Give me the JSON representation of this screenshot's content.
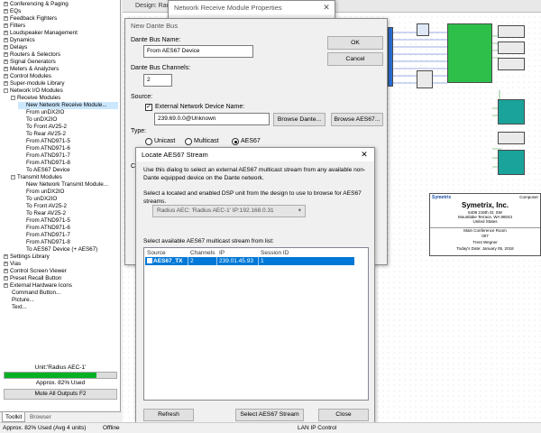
{
  "tree": {
    "items": [
      {
        "label": "Conferencing & Paging",
        "expand": "+",
        "selected": false
      },
      {
        "label": "EQs",
        "expand": "+",
        "selected": false
      },
      {
        "label": "Feedback Fighters",
        "expand": "+",
        "selected": false
      },
      {
        "label": "Filters",
        "expand": "+",
        "selected": false
      },
      {
        "label": "Loudspeaker Management",
        "expand": "+",
        "selected": false
      },
      {
        "label": "Dynamics",
        "expand": "+",
        "selected": false
      },
      {
        "label": "Delays",
        "expand": "+",
        "selected": false
      },
      {
        "label": "Routers & Selectors",
        "expand": "+",
        "selected": false
      },
      {
        "label": "Signal Generators",
        "expand": "+",
        "selected": false
      },
      {
        "label": "Meters & Analyzers",
        "expand": "+",
        "selected": false
      },
      {
        "label": "Control Modules",
        "expand": "+",
        "selected": false
      },
      {
        "label": "Super-module Library",
        "expand": "+",
        "selected": false
      },
      {
        "label": "Network I/O Modules",
        "expand": "-",
        "selected": false
      },
      {
        "label": "Receive Modules",
        "expand": "-",
        "selected": false
      },
      {
        "label": "New Network Receive Module...",
        "expand": "",
        "selected": true
      },
      {
        "label": "From unDX2IO",
        "expand": "",
        "selected": false
      },
      {
        "label": "To unDX2IO",
        "expand": "",
        "selected": false
      },
      {
        "label": "To Front AV25-2",
        "expand": "",
        "selected": false
      },
      {
        "label": "To Rear AV25-2",
        "expand": "",
        "selected": false
      },
      {
        "label": "From ATND971-5",
        "expand": "",
        "selected": false
      },
      {
        "label": "From ATND971-6",
        "expand": "",
        "selected": false
      },
      {
        "label": "From ATND971-7",
        "expand": "",
        "selected": false
      },
      {
        "label": "From ATND971-8",
        "expand": "",
        "selected": false
      },
      {
        "label": "To AES67 Device",
        "expand": "",
        "selected": false
      },
      {
        "label": "Transmit Modules",
        "expand": "-",
        "selected": false
      },
      {
        "label": "New Network Transmit Module...",
        "expand": "",
        "selected": false
      },
      {
        "label": "From unDX2IO",
        "expand": "",
        "selected": false
      },
      {
        "label": "To unDX2IO",
        "expand": "",
        "selected": false
      },
      {
        "label": "To Front AV25-2",
        "expand": "",
        "selected": false
      },
      {
        "label": "To Rear AV25-2",
        "expand": "",
        "selected": false
      },
      {
        "label": "From ATND971-5",
        "expand": "",
        "selected": false
      },
      {
        "label": "From ATND971-6",
        "expand": "",
        "selected": false
      },
      {
        "label": "From ATND971-7",
        "expand": "",
        "selected": false
      },
      {
        "label": "From ATND971-8",
        "expand": "",
        "selected": false
      },
      {
        "label": "To AES67 Device (+ AES67)",
        "expand": "",
        "selected": false
      },
      {
        "label": "Settings Library",
        "expand": "+",
        "selected": false
      },
      {
        "label": "Vias",
        "expand": "+",
        "selected": false
      },
      {
        "label": "Control Screen Viewer",
        "expand": "+",
        "selected": false
      },
      {
        "label": "Preset Recall Button",
        "expand": "+",
        "selected": false
      },
      {
        "label": "External Hardware Icons",
        "expand": "+",
        "selected": false
      },
      {
        "label": "Command Button...",
        "expand": "",
        "selected": false
      },
      {
        "label": "Picture...",
        "expand": "",
        "selected": false
      },
      {
        "label": "Text...",
        "expand": "",
        "selected": false
      }
    ]
  },
  "left_bottom": {
    "unit_label": "Unit:'Radius AEC-1'",
    "usage_percent": 82,
    "usage_text": "Approx. 82% Used",
    "mute_button": "Mute All Outputs  F2"
  },
  "tabs": {
    "toolkit": "Toolkit",
    "browser": "Browser"
  },
  "statusbar": {
    "usage": "Approx. 82% Used (Avg 4 units)",
    "mode": "Offline",
    "control": "LAN IP Control"
  },
  "design": {
    "title": "Design: Rad",
    "title_block": {
      "brand": "Symetrix",
      "section": "Composer",
      "company": "Symetrix, Inc.",
      "address1": "6408 216th St. SW",
      "address2": "Mountlake Terrace, WA 98043",
      "address3": "United States",
      "room": "Main Conference Room",
      "number": "007",
      "engineer": "Trent Wegner",
      "date": "Today's Date: January 05, 2018"
    },
    "colors": {
      "blue": "#2a6fd6",
      "green": "#2dbf4a",
      "teal": "#1aa39a",
      "gray": "#c8c8c8"
    }
  },
  "props_window": {
    "title": "Network Receive Module Properties",
    "close": "✕"
  },
  "dante_dialog": {
    "title": "New Dante Bus",
    "bus_name_label": "Dante Bus Name:",
    "bus_name_value": "From AES67 Device",
    "channels_label": "Dante Bus Channels:",
    "channels_value": "2",
    "source_label": "Source:",
    "ext_checkbox_label": "External Network Device Name:",
    "ext_checked": true,
    "ext_device_value": "239.69.0.0@Unknown",
    "browse_dante": "Browse Dante...",
    "browse_aes67": "Browse AES67...",
    "type_label": "Type:",
    "type_options": [
      "Unicast",
      "Multicast",
      "AES67"
    ],
    "type_selected": "AES67",
    "ok": "OK",
    "cancel": "Cancel",
    "cut_label": "Ch"
  },
  "locate_dialog": {
    "title": "Locate AES67 Stream",
    "close": "✕",
    "desc1": "Use this dialog to select an external AES67 multicast stream from any available non-Dante equipped device on the Dante network.",
    "desc2": "Select a located and enabled DSP unit from the design to use to browse for AES67 streams.",
    "unit_select": "Radius AEC: 'Radius AEC-1' IP:192.168.0.31",
    "list_label": "Select available AES67 multicast stream from list:",
    "columns": [
      "Source",
      "Channels",
      "IP",
      "Session ID"
    ],
    "rows": [
      {
        "source": "AES67_TX",
        "channels": "2",
        "ip": "239.01.45.93",
        "session": "1",
        "selected": true
      }
    ],
    "refresh": "Refresh",
    "select": "Select AES67 Stream",
    "close_btn": "Close"
  }
}
